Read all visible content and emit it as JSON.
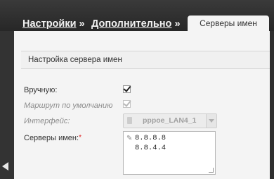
{
  "breadcrumb": {
    "item1": "Настройки",
    "sep1": " »",
    "item2": "Дополнительно",
    "sep2": " »"
  },
  "tab": {
    "label": "Серверы имен"
  },
  "section": {
    "title": "Настройка сервера имен"
  },
  "form": {
    "manual_label": "Вручную:",
    "manual_checked": true,
    "default_route_label": "Маршрут по умолчанию",
    "default_route_checked": true,
    "interface_label": "Интерфейс:",
    "interface_value": "pppoe_LAN4_1",
    "servers_label": "Серверы имен:",
    "required_mark": "*",
    "servers": [
      "8.8.8.8",
      "8.8.4.4"
    ]
  }
}
